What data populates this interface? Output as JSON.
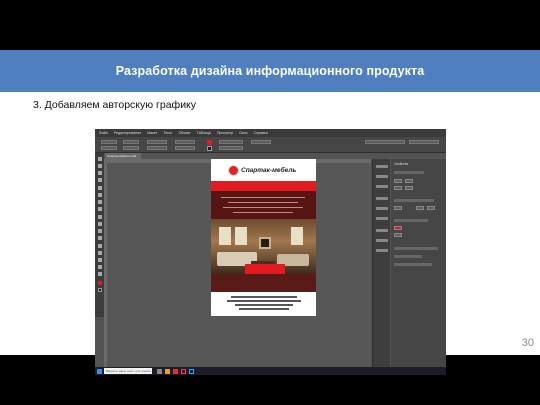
{
  "banner": {
    "title": "Разработка дизайна информационного продукта"
  },
  "step": {
    "text": "3. Добавляем авторскую графику"
  },
  "slide": {
    "number": "30"
  },
  "screenshot": {
    "menu": [
      "Файл",
      "Редактирование",
      "Макет",
      "Текст",
      "Объект",
      "Таблица",
      "Просмотр",
      "Окно",
      "Справка"
    ],
    "document_tab": "Спартак-мебель.indd",
    "logo_text": "Спартак-мебель",
    "properties_title": "Свойства",
    "search_placeholder": "Введите здесь текст для поиска",
    "colors": {
      "accent_red": "#e21b23",
      "dark_red": "#561413",
      "banner_blue": "#4f7fbe"
    },
    "icons": [
      "logo-circle-icon",
      "windows-start-icon"
    ]
  }
}
